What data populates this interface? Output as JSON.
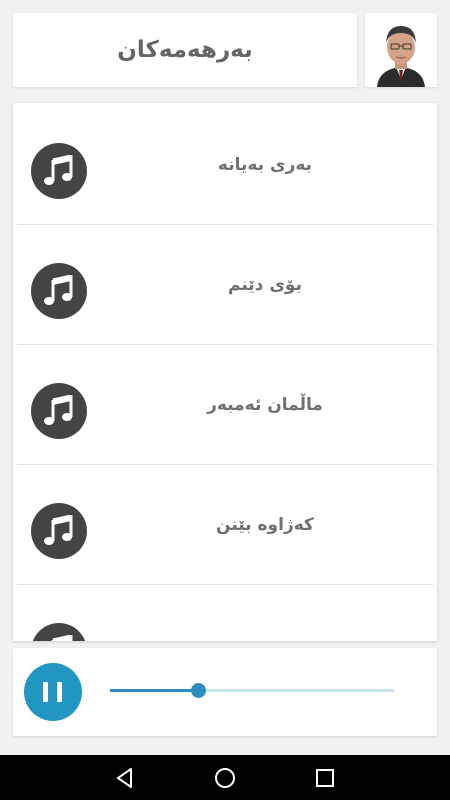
{
  "header": {
    "title": "بەرهەمەکان"
  },
  "songs": [
    {
      "title": "بەری بەیانە"
    },
    {
      "title": "بۆی دێنم"
    },
    {
      "title": "ماڵمان ئەمبەر"
    },
    {
      "title": "کەژاوە بێنن"
    },
    {
      "title": ""
    }
  ],
  "player": {
    "progress_percent": 31,
    "state": "playing",
    "accent": "#2196c3"
  },
  "icons": {
    "song": "music-note-icon",
    "play_pause": "pause-icon",
    "nav": [
      "back-triangle-icon",
      "home-circle-icon",
      "recents-square-icon"
    ]
  }
}
